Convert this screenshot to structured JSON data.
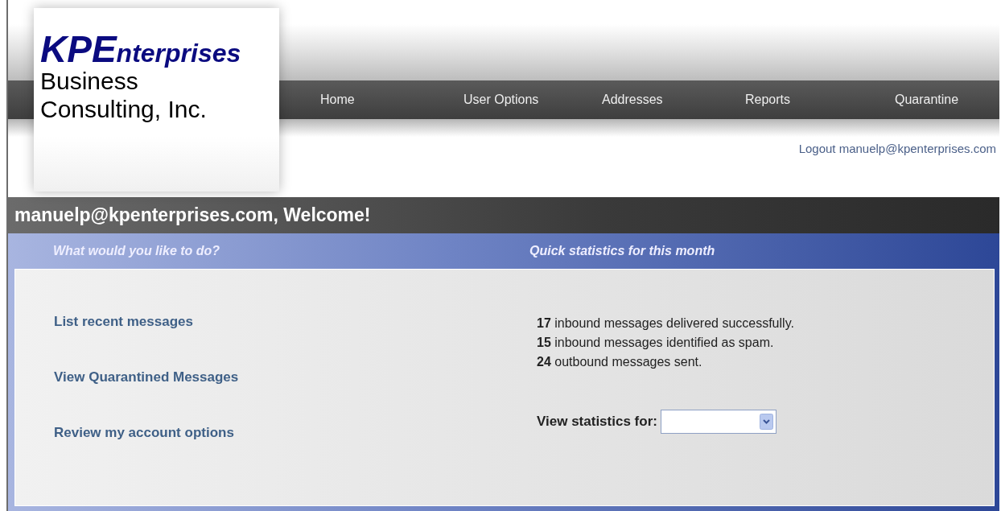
{
  "logo": {
    "lead": "KPE",
    "tail": "nterprises",
    "lines": [
      "Business",
      "Consulting, Inc."
    ]
  },
  "nav": [
    {
      "label": "Home"
    },
    {
      "label": "User Options"
    },
    {
      "label": "Addresses"
    },
    {
      "label": "Reports"
    },
    {
      "label": "Quarantine"
    }
  ],
  "logout": {
    "label": "Logout",
    "email": "manuelp@kpenterprises.com"
  },
  "welcome": "manuelp@kpenterprises.com, Welcome!",
  "panel": {
    "left_heading": "What would you like to do?",
    "right_heading": "Quick statistics for this month",
    "actions": [
      "List recent messages",
      "View Quarantined Messages",
      "Review my account options"
    ],
    "stats": [
      "**17** inbound messages delivered successfully.",
      "**15** inbound messages identified as spam.",
      "**24** outbound messages sent."
    ],
    "period_label": "View statistics for:"
  }
}
